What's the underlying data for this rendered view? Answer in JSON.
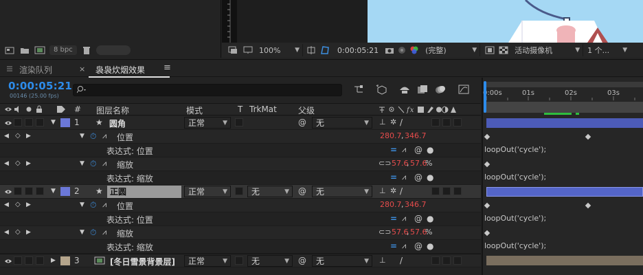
{
  "project_panel": {
    "bpc_label": "8 bpc"
  },
  "viewer_bar": {
    "zoom": "100%",
    "timecode": "0:00:05:21",
    "resolution": "(完整)",
    "camera": "活动摄像机",
    "views": "1 个..."
  },
  "tabs": [
    {
      "label": "渲染队列"
    },
    {
      "label": "袅袅炊烟效果"
    }
  ],
  "comp": {
    "timecode": "0:00:05:21",
    "frame_info": "00146 (25.00 fps)",
    "search_placeholder": ""
  },
  "columns": {
    "num": "#",
    "layer_name": "图层名称",
    "mode": "模式",
    "t": "T",
    "trkmat": "TrkMat",
    "parent": "父级"
  },
  "timeline": {
    "ticks": [
      "0:00s",
      "01s",
      "02s",
      "03s"
    ]
  },
  "layers": [
    {
      "num": "1",
      "name": "圆角",
      "mode": "正常",
      "trkmat": "",
      "parent": "无",
      "color": "#6b78d8",
      "properties": [
        {
          "name": "位置",
          "value_a": "280.7",
          "value_b": "346.7",
          "suffix": "",
          "expression_label": "表达式: 位置",
          "expression": "loopOut('cycle');"
        },
        {
          "name": "缩放",
          "value_a": "57.6",
          "value_b": "57.6",
          "suffix": "%",
          "expression_label": "表达式: 缩放",
          "expression": "loopOut('cycle');"
        }
      ]
    },
    {
      "num": "2",
      "name": "正圆",
      "mode": "正常",
      "trkmat": "无",
      "parent": "无",
      "color": "#6b78d8",
      "properties": [
        {
          "name": "位置",
          "value_a": "280.7",
          "value_b": "346.7",
          "suffix": "",
          "expression_label": "表达式: 位置",
          "expression": "loopOut('cycle');"
        },
        {
          "name": "缩放",
          "value_a": "57.6",
          "value_b": "57.6",
          "suffix": "%",
          "expression_label": "表达式: 缩放",
          "expression": "loopOut('cycle');"
        }
      ]
    },
    {
      "num": "3",
      "name": "[冬日雪景背景层]",
      "mode": "正常",
      "trkmat": "无",
      "parent": "无",
      "color": "#b5a58c"
    }
  ],
  "colors": {
    "accent_blue": "#2d8ceb",
    "value_red": "#e74c4c",
    "layer_bar_blue": "#4c5bb8",
    "layer_bar_tan": "#7a6e5e",
    "work_area_green": "#2ebd3e"
  }
}
